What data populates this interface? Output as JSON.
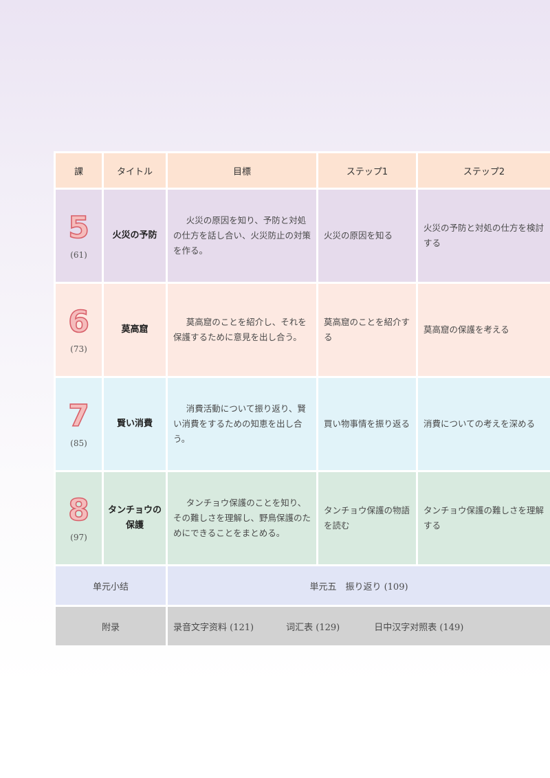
{
  "header": {
    "lesson": "課",
    "title": "タイトル",
    "goal": "目標",
    "step1": "ステップ1",
    "step2": "ステップ2"
  },
  "lessons": [
    {
      "number": "5",
      "page": "(61)",
      "title": "火災の予防",
      "goal": "火災の原因を知り、予防と対処の仕方を話し合い、火災防止の対策を作る。",
      "step1": "火災の原因を知る",
      "step2": "火災の予防と対処の仕方を検討する"
    },
    {
      "number": "6",
      "page": "(73)",
      "title": "莫高窟",
      "goal": "莫高窟のことを紹介し、それを保護するために意見を出し合う。",
      "step1": "莫高窟のことを紹介する",
      "step2": "莫高窟の保護を考える"
    },
    {
      "number": "7",
      "page": "(85)",
      "title": "賢い消費",
      "goal": "消費活動について振り返り、賢い消費をするための知恵を出し合う。",
      "step1": "買い物事情を振り返る",
      "step2": "消費についての考えを深める"
    },
    {
      "number": "8",
      "page": "(97)",
      "title": "タンチョウの保護",
      "goal": "タンチョウ保護のことを知り、その難しさを理解し、野鳥保護のためにできることをまとめる。",
      "step1": "タンチョウ保護の物語を読む",
      "step2": "タンチョウ保護の難しさを理解する"
    }
  ],
  "summary": {
    "label": "单元小结",
    "content": "単元五　振り返り (109)"
  },
  "appendix": {
    "label": "附录",
    "items": [
      "录音文字资料 (121)",
      "词汇表 (129)",
      "日中汉字对照表 (149)"
    ]
  },
  "colors": {
    "header_bg": "#fde3d2",
    "lesson5_bg": "#e6dbec",
    "lesson6_bg": "#fde9e2",
    "lesson7_bg": "#e1f3f9",
    "lesson8_bg": "#d8eadf",
    "summary_bg": "#e1e5f6",
    "appendix_bg": "#d2d2d2",
    "number_fill": "#f5bcbc",
    "number_outline": "#d8606a"
  }
}
